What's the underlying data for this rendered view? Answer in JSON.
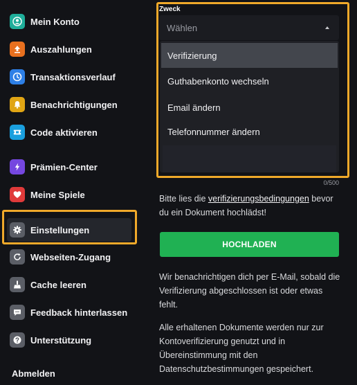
{
  "colors": {
    "background": "#121317",
    "highlight": "#f0a92a",
    "primary_button": "#20b153",
    "selected_option": "#43464d"
  },
  "sidebar": {
    "items": [
      {
        "label": "Mein Konto",
        "icon": "user-circle-icon",
        "color": "#1fae9a"
      },
      {
        "label": "Auszahlungen",
        "icon": "upload-arrow-icon",
        "color": "#e8701f"
      },
      {
        "label": "Transaktionsverlauf",
        "icon": "clock-icon",
        "color": "#2d7fe6"
      },
      {
        "label": "Benachrichtigungen",
        "icon": "bell-icon",
        "color": "#e0a514"
      },
      {
        "label": "Code aktivieren",
        "icon": "ticket-icon",
        "color": "#1a9fde"
      },
      {
        "label": "Prämien-Center",
        "icon": "lightning-icon",
        "color": "#7547e0"
      },
      {
        "label": "Meine Spiele",
        "icon": "heart-icon",
        "color": "#e03a3a"
      },
      {
        "label": "Einstellungen",
        "icon": "gear-icon",
        "color": "#5b5e66"
      },
      {
        "label": "Webseiten-Zugang",
        "icon": "refresh-icon",
        "color": "#5b5e66"
      },
      {
        "label": "Cache leeren",
        "icon": "broom-icon",
        "color": "#5b5e66"
      },
      {
        "label": "Feedback hinterlassen",
        "icon": "chat-bubble-icon",
        "color": "#5b5e66"
      },
      {
        "label": "Unterstützung",
        "icon": "question-icon",
        "color": "#5b5e66"
      }
    ],
    "active_item": "Einstellungen",
    "logout_label": "Abmelden"
  },
  "form": {
    "purpose_label": "Zweck",
    "select_placeholder": "Wählen",
    "options": [
      "Verifizierung",
      "Guthabenkonto wechseln",
      "Email ändern",
      "Telefonnummer ändern"
    ],
    "selected_option": "Verifizierung",
    "char_counter": "0/500",
    "notice_before": "Bitte lies die ",
    "notice_link": "verifizierungsbedingungen",
    "notice_after": " bevor du ein Dokument hochlädst!",
    "upload_button": "HOCHLADEN",
    "info_email": "Wir benachrichtigen dich per E-Mail, sobald die Verifizierung abgeschlossen ist oder etwas fehlt.",
    "info_privacy": "Alle erhaltenen Dokumente werden nur zur Kontoverifizierung genutzt und in Übereinstimmung mit den Datenschutzbestimmungen gespeichert."
  }
}
